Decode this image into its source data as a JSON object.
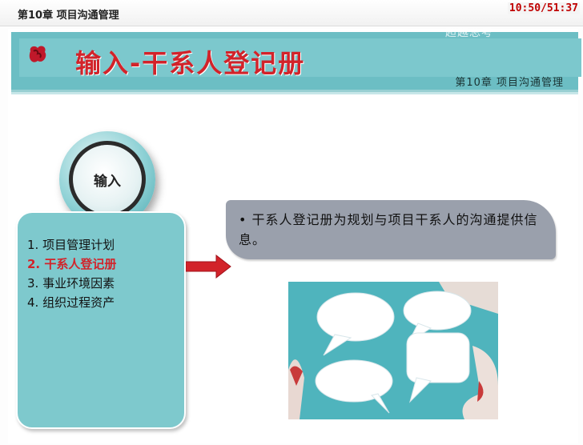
{
  "header": {
    "title": "第10章 项目沟通管理",
    "timer": "10:50/51:37"
  },
  "watermark": "超越总考",
  "slide": {
    "title": "输入-干系人登记册",
    "subtitle": "第10章 项目沟通管理",
    "circle_label": "输入",
    "inputs": [
      {
        "label": "1. 项目管理计划"
      },
      {
        "label": "2. 干系人登记册",
        "active": true
      },
      {
        "label": "3. 事业环境因素"
      },
      {
        "label": "4. 组织过程资产"
      }
    ],
    "callout": {
      "bullet": "•",
      "text": "干系人登记册为规划与项目干系人的沟通提供信息。"
    },
    "icons": [
      "logo-icon",
      "arrow-right-icon",
      "speech-bubbles-image"
    ],
    "colors": {
      "teal": "#7ec9cd",
      "accent": "#d2232a",
      "callout": "#9aa0ac"
    }
  }
}
